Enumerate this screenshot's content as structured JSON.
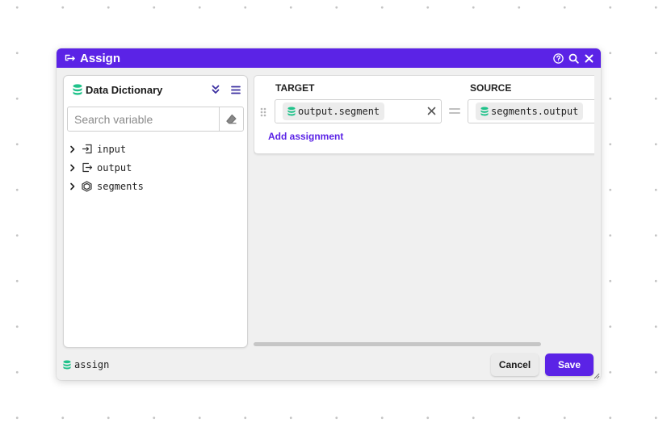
{
  "dialog": {
    "title": "Assign",
    "icons": {
      "title": "assign-arrow-icon",
      "help": "help-icon",
      "search": "search-icon",
      "close": "close-icon"
    }
  },
  "data_dictionary": {
    "title": "Data Dictionary",
    "search_placeholder": "Search variable",
    "items": [
      {
        "label": "input",
        "icon": "input-arrow-icon"
      },
      {
        "label": "output",
        "icon": "output-arrow-icon"
      },
      {
        "label": "segments",
        "icon": "hexagon-icon"
      }
    ]
  },
  "assignment": {
    "target_header": "TARGET",
    "source_header": "SOURCE",
    "rows": [
      {
        "target": "output.segment",
        "source": "segments.output"
      }
    ],
    "add_label": "Add assignment"
  },
  "footer": {
    "node_label": "assign",
    "cancel_label": "Cancel",
    "save_label": "Save"
  },
  "colors": {
    "accent": "#5b23e6",
    "data_icon": "#1fc28a"
  }
}
